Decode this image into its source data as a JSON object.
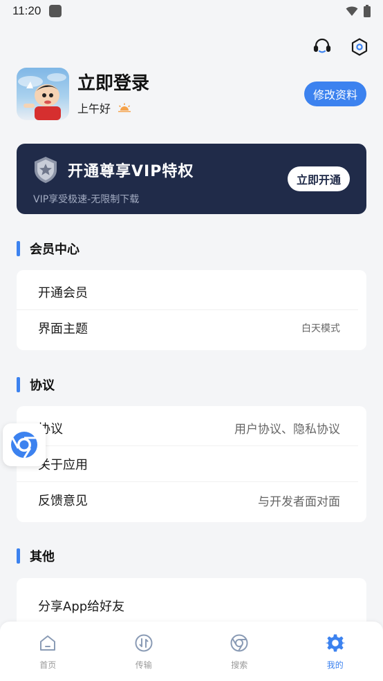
{
  "status_bar": {
    "time": "11:20"
  },
  "profile": {
    "login_title": "立即登录",
    "greeting": "上午好",
    "edit_button": "修改资料"
  },
  "vip": {
    "title": "开通尊享VIP特权",
    "subtitle": "VIP享受极速-无限制下载",
    "button": "立即开通"
  },
  "sections": {
    "member": {
      "title": "会员中心",
      "rows": [
        {
          "label": "开通会员",
          "value": ""
        },
        {
          "label": "界面主题",
          "value": "白天模式"
        }
      ]
    },
    "agreement": {
      "title": "协议",
      "rows": [
        {
          "label": "协议",
          "value": "用户协议、隐私协议"
        },
        {
          "label": "关于应用",
          "value": ""
        },
        {
          "label": "反馈意见",
          "value": "与开发者面对面"
        }
      ]
    },
    "other": {
      "title": "其他",
      "rows": [
        {
          "label": "分享App给好友",
          "value": ""
        }
      ]
    }
  },
  "bottom_nav": {
    "items": [
      {
        "label": "首页",
        "icon": "home-icon"
      },
      {
        "label": "传输",
        "icon": "transfer-icon"
      },
      {
        "label": "搜索",
        "icon": "search-browser-icon"
      },
      {
        "label": "我的",
        "icon": "gear-icon"
      }
    ],
    "active_index": 3
  },
  "colors": {
    "accent": "#3c82ef",
    "vip_bg": "#202b49",
    "page_bg": "#f4f5f7"
  }
}
